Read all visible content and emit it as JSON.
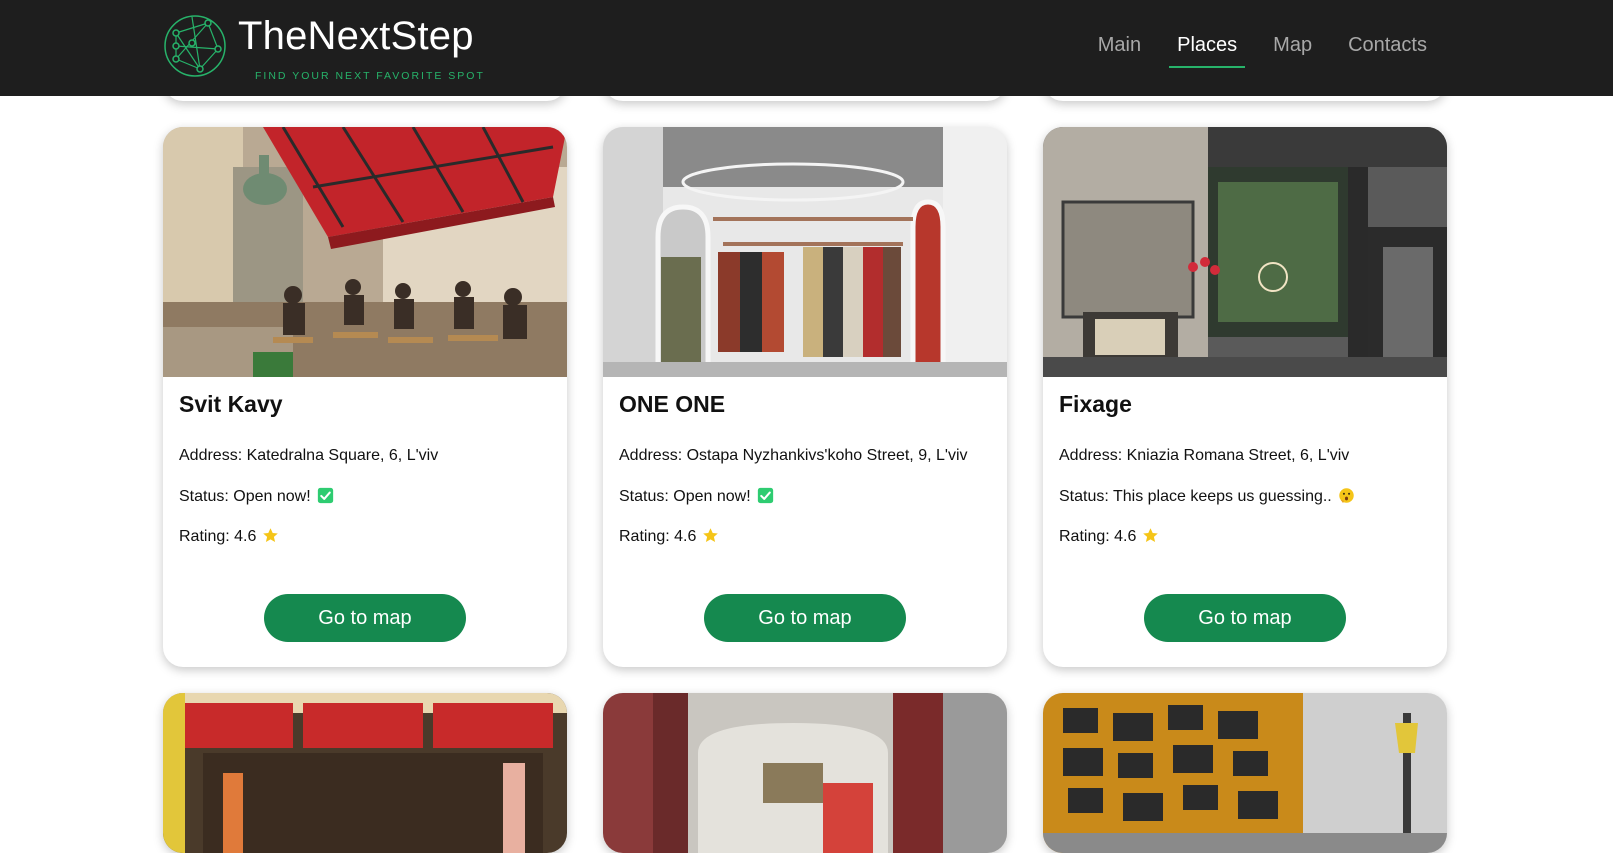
{
  "header": {
    "brand": "TheNextStep",
    "tagline": "FIND YOUR NEXT FAVORITE SPOT",
    "nav": [
      {
        "label": "Main"
      },
      {
        "label": "Places"
      },
      {
        "label": "Map"
      },
      {
        "label": "Contacts"
      }
    ],
    "active_nav": "Places",
    "accent_color": "#27b36a",
    "background_color": "#1e1e1e"
  },
  "places": [
    {
      "name": "Svit Kavy",
      "address": "Address: Katedralna Square, 6, L'viv",
      "status": "Status: Open now!",
      "status_icon": "green-checkmark-icon",
      "rating": "Rating: 4.6",
      "rating_icon": "star-icon",
      "button_label": "Go to map",
      "photo": "outdoor-cafe-terrace-photo"
    },
    {
      "name": "ONE ONE",
      "address": "Address: Ostapa Nyzhankivs'koho Street, 9, L'viv",
      "status": "Status: Open now!",
      "status_icon": "green-checkmark-icon",
      "rating": "Rating: 4.6",
      "rating_icon": "star-icon",
      "button_label": "Go to map",
      "photo": "clothing-store-interior-photo"
    },
    {
      "name": "Fixage",
      "address": "Address: Kniazia Romana Street, 6, L'viv",
      "status": "Status: This place keeps us guessing..",
      "status_icon": "thinking-face-icon",
      "rating": "Rating: 4.6",
      "rating_icon": "star-icon",
      "button_label": "Go to map",
      "photo": "vintage-cafe-storefront-photo"
    }
  ],
  "button_color": "#15894f"
}
